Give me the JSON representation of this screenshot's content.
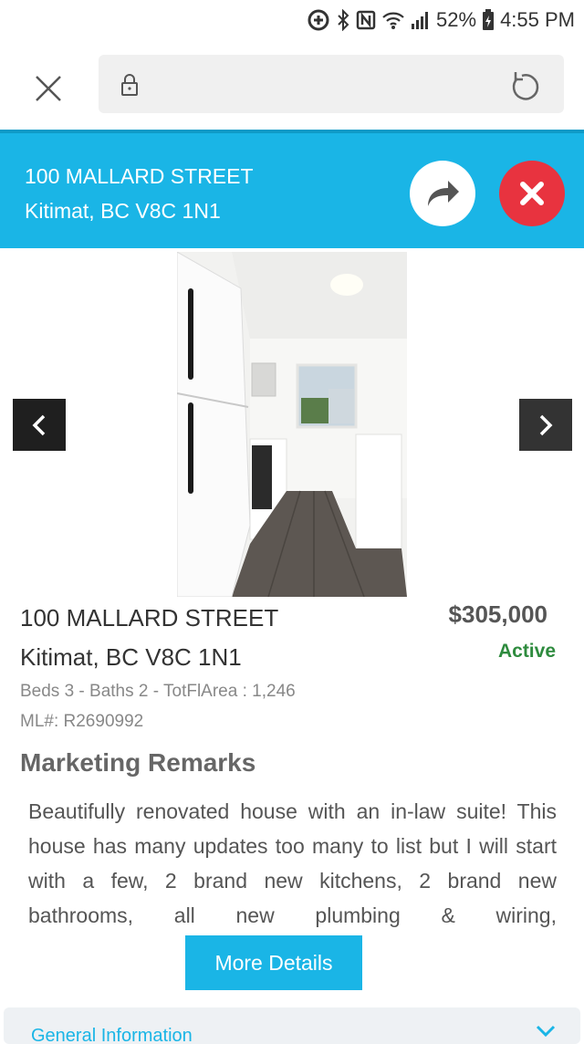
{
  "status_bar": {
    "battery": "52%",
    "time": "4:55 PM",
    "icons": [
      "data-saver-icon",
      "bluetooth-icon",
      "nfc-icon",
      "wifi-icon",
      "signal-icon",
      "battery-icon"
    ]
  },
  "browser": {
    "close_icon": "close-icon",
    "lock_icon": "lock-icon",
    "reload_icon": "reload-icon",
    "url": ""
  },
  "listing_header": {
    "address_line1": "100 MALLARD STREET",
    "address_line2": "Kitimat, BC V8C 1N1",
    "share_icon": "share-arrow-icon",
    "close_icon": "close-circle-icon"
  },
  "gallery": {
    "prev_icon": "chevron-left-icon",
    "next_icon": "chevron-right-icon",
    "image": "kitchen-photo"
  },
  "listing": {
    "street": "100 MALLARD STREET",
    "city": "Kitimat, BC V8C 1N1",
    "price": "$305,000",
    "status": "Active",
    "facts": "Beds 3 - Baths 2 - TotFlArea : 1,246",
    "ml_number": "ML#: R2690992"
  },
  "remarks": {
    "title": "Marketing Remarks",
    "text": "Beautifully renovated house with an in-law suite! This house has many updates too many to list but I will start with a few, 2 brand new kitchens, 2 brand new bathrooms, all new plumbing & wiring,",
    "more_button": "More Details"
  },
  "accordion": {
    "label": "General Information",
    "chevron_icon": "chevron-down-icon"
  },
  "colors": {
    "accent": "#1ab5e6",
    "cancel": "#e8333f",
    "active_status": "#2e8b3e"
  }
}
